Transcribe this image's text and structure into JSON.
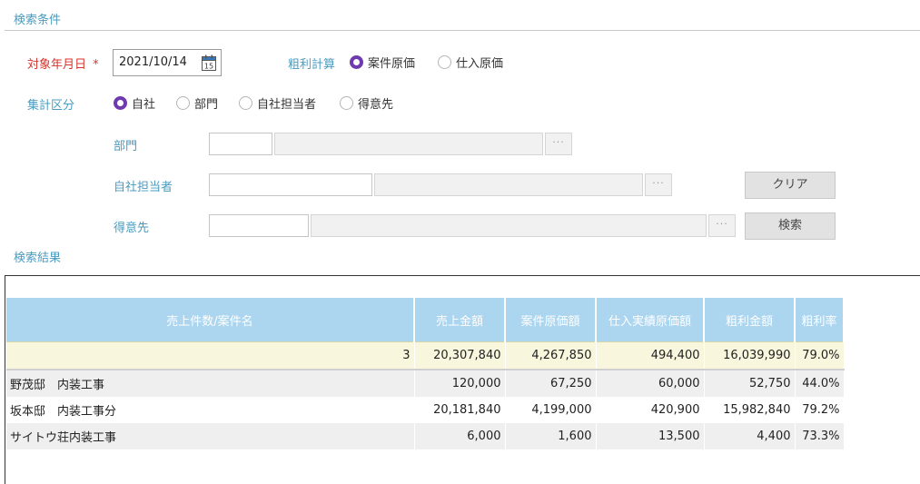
{
  "search": {
    "section_title": "検索条件",
    "target_date_label": "対象年月日",
    "required_mark": "*",
    "target_date_value": "2021/10/14",
    "gross_calc_label": "粗利計算",
    "gross_calc_options": [
      {
        "label": "案件原価",
        "selected": true
      },
      {
        "label": "仕入原価",
        "selected": false
      }
    ],
    "aggregate_label": "集計区分",
    "aggregate_options": [
      {
        "label": "自社",
        "selected": true
      },
      {
        "label": "部門",
        "selected": false
      },
      {
        "label": "自社担当者",
        "selected": false
      },
      {
        "label": "得意先",
        "selected": false
      }
    ],
    "department_label": "部門",
    "staff_label": "自社担当者",
    "customer_label": "得意先",
    "dots": "···",
    "clear_button": "クリア",
    "search_button": "検索"
  },
  "results": {
    "section_title": "検索結果",
    "headers": [
      "売上件数/案件名",
      "売上金額",
      "案件原価額",
      "仕入実績原価額",
      "粗利金額",
      "粗利率"
    ],
    "total": {
      "count": "3",
      "sales": "20,307,840",
      "project_cost": "4,267,850",
      "purchase_cost": "494,400",
      "gross": "16,039,990",
      "rate": "79.0%"
    },
    "rows": [
      {
        "name": "野茂邸　内装工事",
        "sales": "120,000",
        "project_cost": "67,250",
        "purchase_cost": "60,000",
        "gross": "52,750",
        "rate": "44.0%"
      },
      {
        "name": "坂本邸　内装工事分",
        "sales": "20,181,840",
        "project_cost": "4,199,000",
        "purchase_cost": "420,900",
        "gross": "15,982,840",
        "rate": "79.2%"
      },
      {
        "name": "サイトウ荘内装工事",
        "sales": "6,000",
        "project_cost": "1,600",
        "purchase_cost": "13,500",
        "gross": "4,400",
        "rate": "73.3%"
      }
    ]
  },
  "colors": {
    "accent_blue": "#4a9bbf",
    "required_red": "#d9322b",
    "radio_purple": "#6f3ab0",
    "header_blue": "#acd5ef"
  }
}
